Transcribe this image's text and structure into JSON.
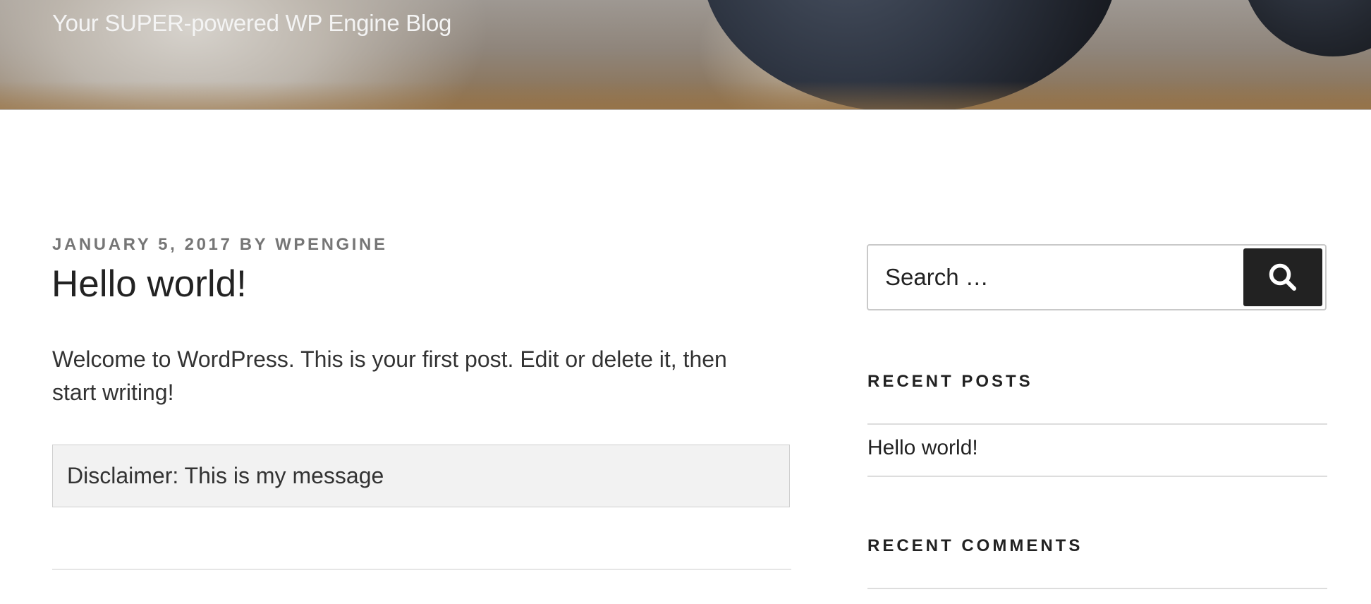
{
  "header": {
    "tagline": "Your SUPER-powered WP Engine Blog"
  },
  "post": {
    "date": "JANUARY 5, 2017",
    "by": "BY",
    "author": "WPENGINE",
    "title": "Hello world!",
    "body": "Welcome to WordPress. This is your first post. Edit or delete it, then start writing!",
    "disclaimer": "Disclaimer: This is my message"
  },
  "sidebar": {
    "search": {
      "placeholder": "Search …"
    },
    "recent_posts": {
      "title": "RECENT POSTS",
      "items": [
        {
          "label": "Hello world!"
        }
      ]
    },
    "recent_comments": {
      "title": "RECENT COMMENTS"
    }
  },
  "colors": {
    "text": "#222222",
    "meta": "#767676",
    "search_button_bg": "#222222",
    "disclaimer_bg": "#f2f2f2"
  },
  "icons": {
    "search": "search-icon"
  }
}
